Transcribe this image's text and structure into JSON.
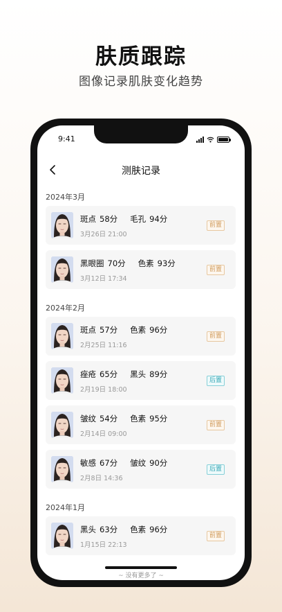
{
  "hero": {
    "title": "肤质跟踪",
    "subtitle": "图像记录肌肤变化趋势"
  },
  "status_bar": {
    "time": "9:41"
  },
  "nav": {
    "title": "测肤记录",
    "back_icon": "chevron-left-icon"
  },
  "groups": [
    {
      "month": "2024年3月",
      "records": [
        {
          "m1_name": "斑点",
          "m1_val": "58分",
          "m2_name": "毛孔",
          "m2_val": "94分",
          "date": "3月26日 21:00",
          "tag": "前置",
          "tag_type": "front"
        },
        {
          "m1_name": "黑眼圈",
          "m1_val": "70分",
          "m2_name": "色素",
          "m2_val": "93分",
          "date": "3月12日 17:34",
          "tag": "前置",
          "tag_type": "front"
        }
      ]
    },
    {
      "month": "2024年2月",
      "records": [
        {
          "m1_name": "斑点",
          "m1_val": "57分",
          "m2_name": "色素",
          "m2_val": "96分",
          "date": "2月25日 11:16",
          "tag": "前置",
          "tag_type": "front"
        },
        {
          "m1_name": "痤疮",
          "m1_val": "65分",
          "m2_name": "黑头",
          "m2_val": "89分",
          "date": "2月19日 18:00",
          "tag": "后置",
          "tag_type": "back"
        },
        {
          "m1_name": "皱纹",
          "m1_val": "54分",
          "m2_name": "色素",
          "m2_val": "95分",
          "date": "2月14日 09:00",
          "tag": "前置",
          "tag_type": "front"
        },
        {
          "m1_name": "敏感",
          "m1_val": "67分",
          "m2_name": "皱纹",
          "m2_val": "90分",
          "date": "2月8日 14:36",
          "tag": "后置",
          "tag_type": "back"
        }
      ]
    },
    {
      "month": "2024年1月",
      "records": [
        {
          "m1_name": "黑头",
          "m1_val": "63分",
          "m2_name": "色素",
          "m2_val": "96分",
          "date": "1月15日 22:13",
          "tag": "前置",
          "tag_type": "front"
        }
      ]
    }
  ],
  "footer": {
    "no_more": "~ 没有更多了 ~"
  },
  "colors": {
    "tag_front": "#d09a5a",
    "tag_back": "#35a7b5",
    "card_bg": "#f6f6f6"
  }
}
